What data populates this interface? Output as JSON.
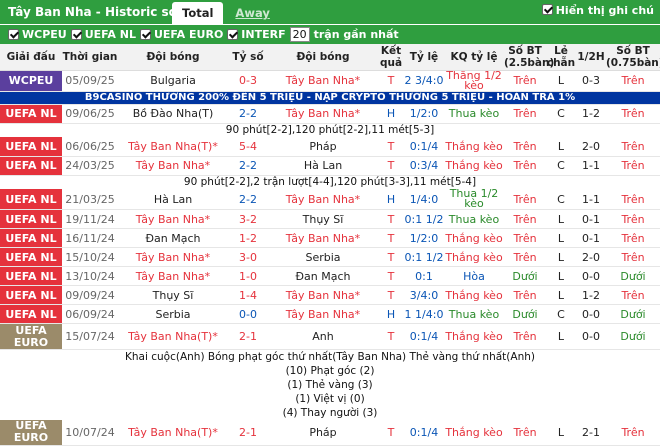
{
  "header": {
    "title": "Tây Ban Nha - Historic scores",
    "tabs": [
      {
        "label": "Total"
      },
      {
        "label": "Away"
      }
    ]
  },
  "filters": {
    "items": [
      "WCPEU",
      "UEFA NL",
      "UEFA EURO",
      "INTERF"
    ],
    "show_notes_label": "Hiển thị ghi chú",
    "count_value": "20",
    "count_suffix": "trận gần nhất"
  },
  "columns": [
    "Giải đấu",
    "Thời gian",
    "Đội bóng",
    "Tỷ số",
    "Đội bóng",
    "Kết quả",
    "Tỷ lệ",
    "KQ tỷ lệ",
    "Số BT (2.5bàn)",
    "Lẻ chẵn",
    "1/2H",
    "Số BT (0.75bàn)"
  ],
  "colors": {
    "wcpeu": "#5b3f9e",
    "uefanl": "#e5323c",
    "uefaeuro": "#9b8b6a",
    "header_green": "#2f9e3f"
  },
  "ad_banner": "B9CASINO THƯỞNG 200% ĐẾN 5 TRIỆU - NẠP CRYPTO THƯỞNG 5 TRIỆU - HOÀN TRẢ 1%",
  "rows": [
    {
      "league": "WCPEU",
      "date": "05/09/25",
      "home": "Bulgaria",
      "score": "0-3",
      "away": "Tây Ban Nha*",
      "res": "T",
      "odds": "2 3/4:0",
      "oddres": "Thắng 1/2 kèo",
      "ou": "Trên",
      "oe": "L",
      "half": "0-3",
      "ou2": "Trên"
    },
    {
      "league": "UEFA NL",
      "date": "09/06/25",
      "home": "Bồ Đào Nha(T)",
      "score": "2-2",
      "away": "Tây Ban Nha*",
      "res": "H",
      "odds": "1/2:0",
      "oddres": "Thua kèo",
      "ou": "Trên",
      "oe": "C",
      "half": "1-2",
      "ou2": "Trên"
    },
    {
      "league": "UEFA NL",
      "date": "06/06/25",
      "home": "Tây Ban Nha(T)*",
      "score": "5-4",
      "away": "Pháp",
      "res": "T",
      "odds": "0:1/4",
      "oddres": "Thắng kèo",
      "ou": "Trên",
      "oe": "L",
      "half": "2-0",
      "ou2": "Trên"
    },
    {
      "league": "UEFA NL",
      "date": "24/03/25",
      "home": "Tây Ban Nha*",
      "score": "2-2",
      "away": "Hà Lan",
      "res": "T",
      "odds": "0:3/4",
      "oddres": "Thắng kèo",
      "ou": "Trên",
      "oe": "C",
      "half": "1-1",
      "ou2": "Trên"
    },
    {
      "league": "UEFA NL",
      "date": "21/03/25",
      "home": "Hà Lan",
      "score": "2-2",
      "away": "Tây Ban Nha*",
      "res": "H",
      "odds": "1/4:0",
      "oddres": "Thua 1/2 kèo",
      "ou": "Trên",
      "oe": "C",
      "half": "1-1",
      "ou2": "Trên"
    },
    {
      "league": "UEFA NL",
      "date": "19/11/24",
      "home": "Tây Ban Nha*",
      "score": "3-2",
      "away": "Thụy Sĩ",
      "res": "T",
      "odds": "0:1 1/2",
      "oddres": "Thua kèo",
      "ou": "Trên",
      "oe": "L",
      "half": "0-1",
      "ou2": "Trên"
    },
    {
      "league": "UEFA NL",
      "date": "16/11/24",
      "home": "Đan Mạch",
      "score": "1-2",
      "away": "Tây Ban Nha*",
      "res": "T",
      "odds": "1/2:0",
      "oddres": "Thắng kèo",
      "ou": "Trên",
      "oe": "L",
      "half": "0-1",
      "ou2": "Trên"
    },
    {
      "league": "UEFA NL",
      "date": "15/10/24",
      "home": "Tây Ban Nha*",
      "score": "3-0",
      "away": "Serbia",
      "res": "T",
      "odds": "0:1 1/2",
      "oddres": "Thắng kèo",
      "ou": "Trên",
      "oe": "L",
      "half": "2-0",
      "ou2": "Trên"
    },
    {
      "league": "UEFA NL",
      "date": "13/10/24",
      "home": "Tây Ban Nha*",
      "score": "1-0",
      "away": "Đan Mạch",
      "res": "T",
      "odds": "0:1",
      "oddres": "Hòa",
      "ou": "Dưới",
      "oe": "L",
      "half": "0-0",
      "ou2": "Dưới"
    },
    {
      "league": "UEFA NL",
      "date": "09/09/24",
      "home": "Thụy Sĩ",
      "score": "1-4",
      "away": "Tây Ban Nha*",
      "res": "T",
      "odds": "3/4:0",
      "oddres": "Thắng kèo",
      "ou": "Trên",
      "oe": "L",
      "half": "1-2",
      "ou2": "Trên"
    },
    {
      "league": "UEFA NL",
      "date": "06/09/24",
      "home": "Serbia",
      "score": "0-0",
      "away": "Tây Ban Nha*",
      "res": "H",
      "odds": "1 1/4:0",
      "oddres": "Thua kèo",
      "ou": "Dưới",
      "oe": "C",
      "half": "0-0",
      "ou2": "Dưới"
    },
    {
      "league": "UEFA EURO",
      "date": "15/07/24",
      "home": "Tây Ban Nha(T)*",
      "score": "2-1",
      "away": "Anh",
      "res": "T",
      "odds": "0:1/4",
      "oddres": "Thắng kèo",
      "ou": "Trên",
      "oe": "L",
      "half": "0-0",
      "ou2": "Dưới"
    },
    {
      "league": "UEFA EURO",
      "date": "10/07/24",
      "home": "Tây Ban Nha(T)*",
      "score": "2-1",
      "away": "Pháp",
      "res": "T",
      "odds": "0:1/4",
      "oddres": "Thắng kèo",
      "ou": "Trên",
      "oe": "L",
      "half": "2-1",
      "ou2": "Trên"
    }
  ],
  "notes": {
    "n1": "90 phút[2-2],120 phút[2-2],11 mét[5-3]",
    "n2": "90 phút[2-2],2 trận lượt[4-4],120 phút[3-3],11 mét[5-4]",
    "n3a": "Khai cuộc(Anh)",
    "n3b": "Bóng phạt góc thứ nhất(Tây Ban Nha)",
    "n3c": "Thẻ vàng thứ nhất(Anh)",
    "n4": "(10) Phạt góc (2)",
    "n5": "(1) Thẻ vàng (3)",
    "n6": "(1) Việt vị (0)",
    "n7": "(4) Thay người (3)"
  }
}
